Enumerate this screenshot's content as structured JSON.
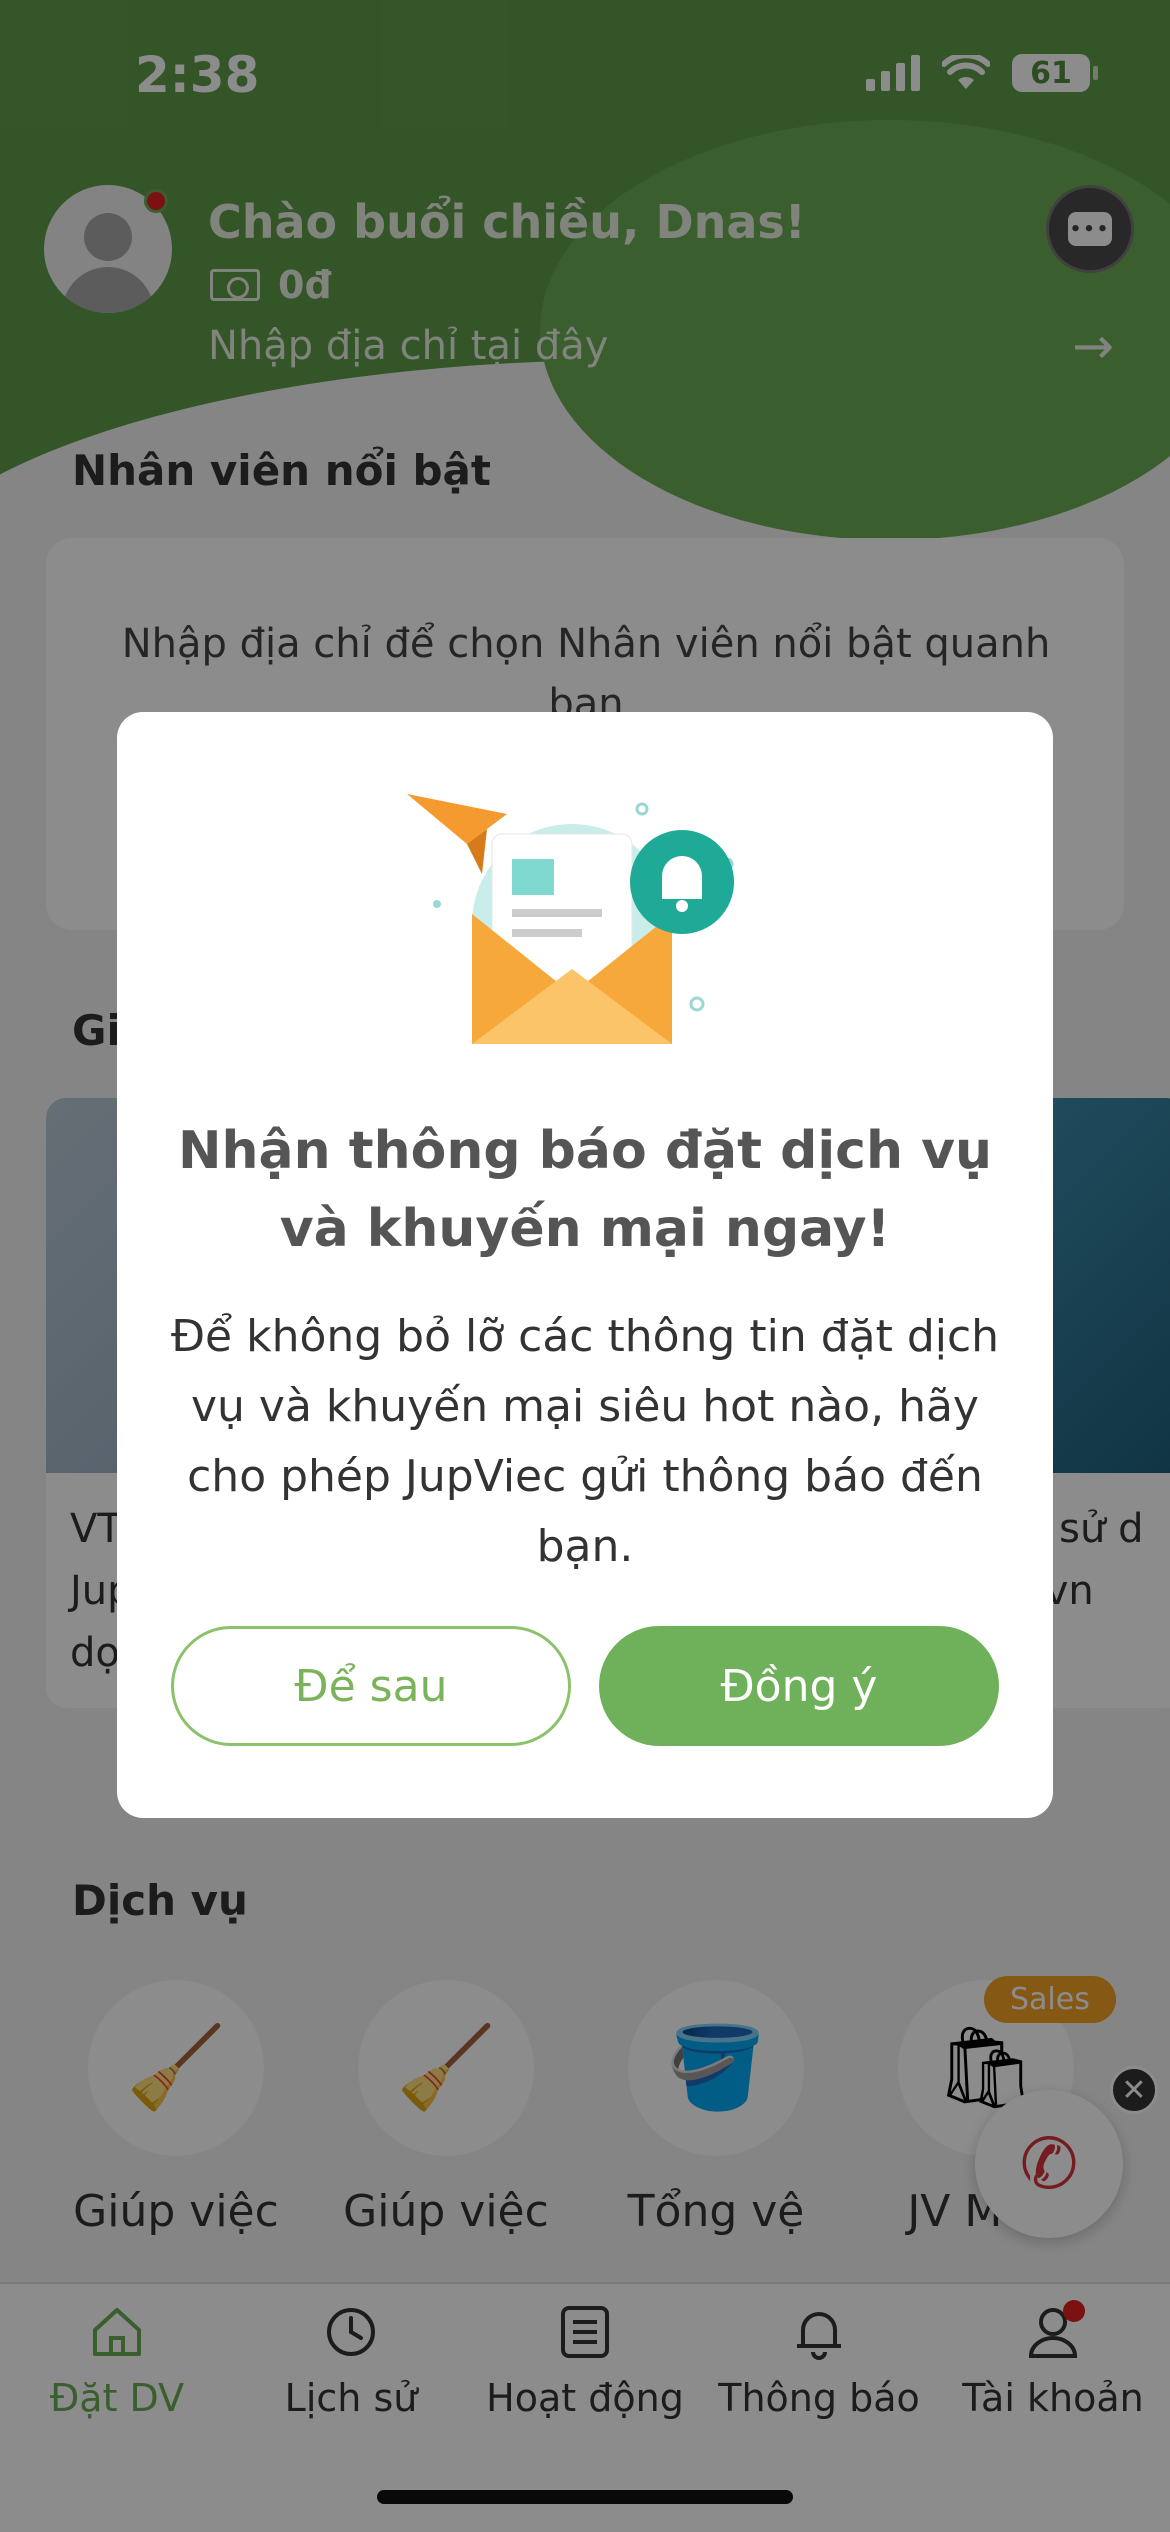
{
  "status_bar": {
    "time": "2:38",
    "battery": "61"
  },
  "header": {
    "greeting": "Chào buổi chiều, Dnas!",
    "balance": "0đ",
    "address_placeholder": "Nhập địa chỉ tại đây"
  },
  "featured": {
    "title": "Nhân viên nổi bật",
    "message": "Nhập địa chỉ để chọn Nhân viên nổi bật quanh bạn"
  },
  "promo": {
    "title": "Gi",
    "cards": [
      {
        "text": "VT\nJup\ndọ"
      },
      {
        "text": "hi sử d\nc.vn"
      }
    ]
  },
  "services": {
    "title": "Dịch vụ",
    "sales_badge": "Sales",
    "items": [
      {
        "label": "Giúp việc",
        "icon": "broom-icon"
      },
      {
        "label": "Giúp việc",
        "icon": "broom-cycle-icon"
      },
      {
        "label": "Tổng vệ",
        "icon": "mop-bucket-icon"
      },
      {
        "label": "JV Mart",
        "icon": "shop-bag-icon"
      }
    ]
  },
  "tabbar": {
    "tabs": [
      {
        "label": "Đặt DV",
        "icon": "home-icon"
      },
      {
        "label": "Lịch sử",
        "icon": "history-icon"
      },
      {
        "label": "Hoạt động",
        "icon": "list-icon"
      },
      {
        "label": "Thông báo",
        "icon": "bell-icon"
      },
      {
        "label": "Tài khoản",
        "icon": "user-icon"
      }
    ]
  },
  "modal": {
    "title": "Nhận thông báo đặt dịch vụ và khuyến mại ngay!",
    "body": "Để không bỏ lỡ các thông tin đặt dịch vụ và khuyến mại siêu hot nào, hãy cho phép JupViec gửi thông báo đến bạn.",
    "later_label": "Để sau",
    "agree_label": "Đồng ý"
  },
  "colors": {
    "brand_green": "#6fb15a",
    "header_green": "#5e9c49",
    "sales_orange": "#f2a024",
    "call_red": "#d5333b"
  }
}
